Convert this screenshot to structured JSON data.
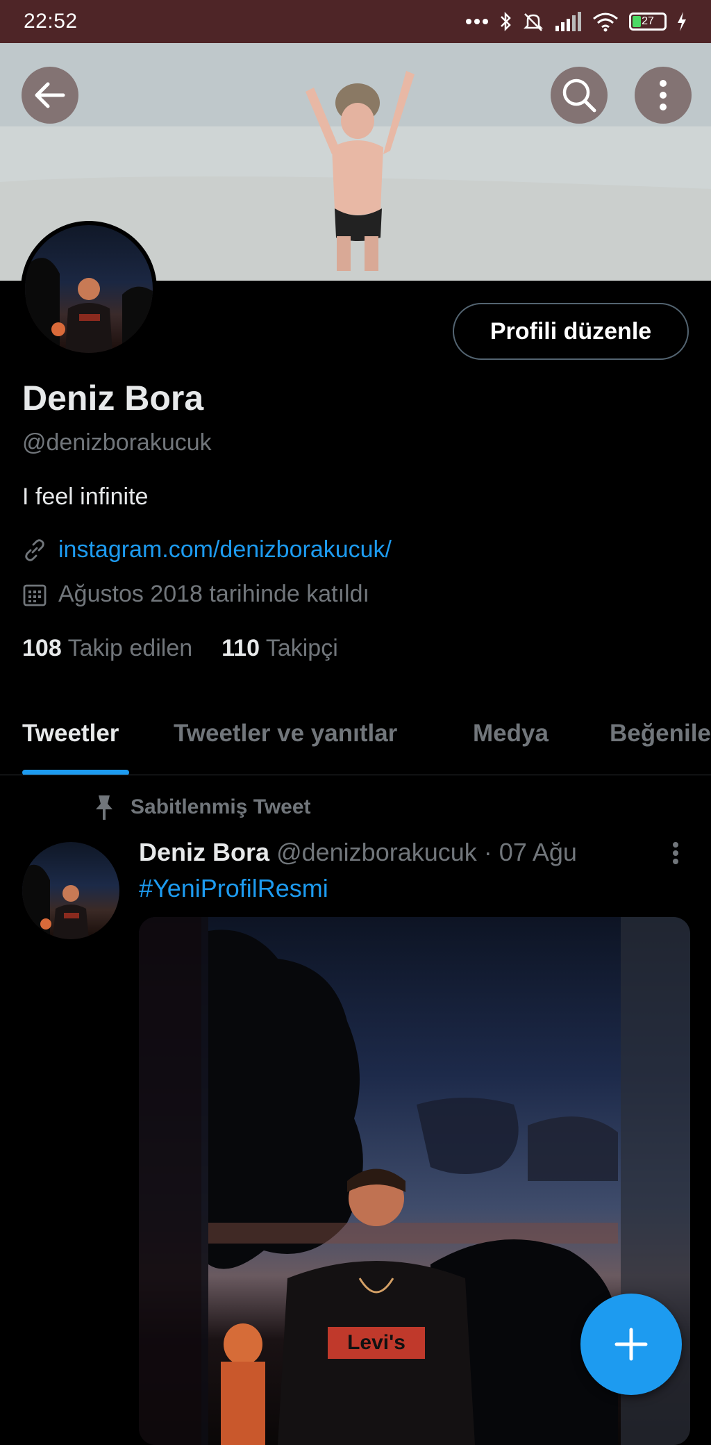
{
  "status_bar": {
    "time": "22:52",
    "battery_level": "27",
    "icons": [
      "dots-icon",
      "bluetooth-icon",
      "mute-icon",
      "signal-icon",
      "wifi-icon",
      "battery-icon",
      "charging-icon"
    ]
  },
  "header": {
    "back_icon": "arrow-left-icon",
    "search_icon": "search-icon",
    "more_icon": "more-vertical-icon"
  },
  "profile": {
    "edit_button_label": "Profili düzenle",
    "name": "Deniz Bora",
    "handle": "@denizborakucuk",
    "bio": "I feel infinite",
    "link": "instagram.com/denizborakucuk/",
    "joined": "Ağustos 2018 tarihinde katıldı",
    "following_count": "108",
    "following_label": "Takip edilen",
    "followers_count": "110",
    "followers_label": "Takipçi"
  },
  "tabs": [
    {
      "label": "Tweetler",
      "active": true
    },
    {
      "label": "Tweetler ve yanıtlar",
      "active": false
    },
    {
      "label": "Medya",
      "active": false
    },
    {
      "label": "Beğeniler",
      "active": false
    }
  ],
  "pinned_tweet": {
    "pinned_label": "Sabitlenmiş Tweet",
    "author_name": "Deniz Bora",
    "author_handle": "@denizborakucuk",
    "separator": "·",
    "date": "07 Ağu",
    "text": "#YeniProfilResmi",
    "shirt_text": "Levi's"
  },
  "colors": {
    "accent": "#1d9bf0",
    "status_bar": "#4e2527",
    "background": "#000000",
    "muted_text": "#71767b"
  }
}
